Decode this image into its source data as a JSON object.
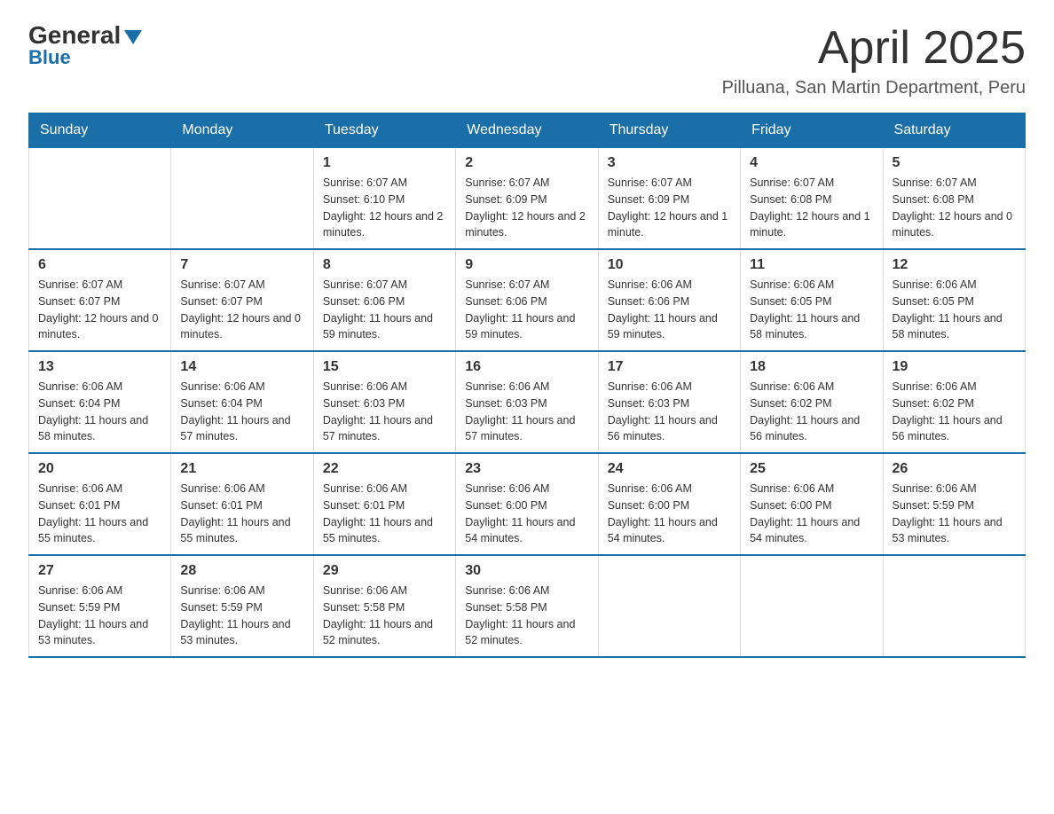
{
  "logo": {
    "general": "General",
    "blue": "Blue"
  },
  "header": {
    "month": "April 2025",
    "location": "Pilluana, San Martin Department, Peru"
  },
  "days_of_week": [
    "Sunday",
    "Monday",
    "Tuesday",
    "Wednesday",
    "Thursday",
    "Friday",
    "Saturday"
  ],
  "weeks": [
    {
      "days": [
        {
          "num": "",
          "info": ""
        },
        {
          "num": "",
          "info": ""
        },
        {
          "num": "1",
          "info": "Sunrise: 6:07 AM\nSunset: 6:10 PM\nDaylight: 12 hours and 2 minutes."
        },
        {
          "num": "2",
          "info": "Sunrise: 6:07 AM\nSunset: 6:09 PM\nDaylight: 12 hours and 2 minutes."
        },
        {
          "num": "3",
          "info": "Sunrise: 6:07 AM\nSunset: 6:09 PM\nDaylight: 12 hours and 1 minute."
        },
        {
          "num": "4",
          "info": "Sunrise: 6:07 AM\nSunset: 6:08 PM\nDaylight: 12 hours and 1 minute."
        },
        {
          "num": "5",
          "info": "Sunrise: 6:07 AM\nSunset: 6:08 PM\nDaylight: 12 hours and 0 minutes."
        }
      ]
    },
    {
      "days": [
        {
          "num": "6",
          "info": "Sunrise: 6:07 AM\nSunset: 6:07 PM\nDaylight: 12 hours and 0 minutes."
        },
        {
          "num": "7",
          "info": "Sunrise: 6:07 AM\nSunset: 6:07 PM\nDaylight: 12 hours and 0 minutes."
        },
        {
          "num": "8",
          "info": "Sunrise: 6:07 AM\nSunset: 6:06 PM\nDaylight: 11 hours and 59 minutes."
        },
        {
          "num": "9",
          "info": "Sunrise: 6:07 AM\nSunset: 6:06 PM\nDaylight: 11 hours and 59 minutes."
        },
        {
          "num": "10",
          "info": "Sunrise: 6:06 AM\nSunset: 6:06 PM\nDaylight: 11 hours and 59 minutes."
        },
        {
          "num": "11",
          "info": "Sunrise: 6:06 AM\nSunset: 6:05 PM\nDaylight: 11 hours and 58 minutes."
        },
        {
          "num": "12",
          "info": "Sunrise: 6:06 AM\nSunset: 6:05 PM\nDaylight: 11 hours and 58 minutes."
        }
      ]
    },
    {
      "days": [
        {
          "num": "13",
          "info": "Sunrise: 6:06 AM\nSunset: 6:04 PM\nDaylight: 11 hours and 58 minutes."
        },
        {
          "num": "14",
          "info": "Sunrise: 6:06 AM\nSunset: 6:04 PM\nDaylight: 11 hours and 57 minutes."
        },
        {
          "num": "15",
          "info": "Sunrise: 6:06 AM\nSunset: 6:03 PM\nDaylight: 11 hours and 57 minutes."
        },
        {
          "num": "16",
          "info": "Sunrise: 6:06 AM\nSunset: 6:03 PM\nDaylight: 11 hours and 57 minutes."
        },
        {
          "num": "17",
          "info": "Sunrise: 6:06 AM\nSunset: 6:03 PM\nDaylight: 11 hours and 56 minutes."
        },
        {
          "num": "18",
          "info": "Sunrise: 6:06 AM\nSunset: 6:02 PM\nDaylight: 11 hours and 56 minutes."
        },
        {
          "num": "19",
          "info": "Sunrise: 6:06 AM\nSunset: 6:02 PM\nDaylight: 11 hours and 56 minutes."
        }
      ]
    },
    {
      "days": [
        {
          "num": "20",
          "info": "Sunrise: 6:06 AM\nSunset: 6:01 PM\nDaylight: 11 hours and 55 minutes."
        },
        {
          "num": "21",
          "info": "Sunrise: 6:06 AM\nSunset: 6:01 PM\nDaylight: 11 hours and 55 minutes."
        },
        {
          "num": "22",
          "info": "Sunrise: 6:06 AM\nSunset: 6:01 PM\nDaylight: 11 hours and 55 minutes."
        },
        {
          "num": "23",
          "info": "Sunrise: 6:06 AM\nSunset: 6:00 PM\nDaylight: 11 hours and 54 minutes."
        },
        {
          "num": "24",
          "info": "Sunrise: 6:06 AM\nSunset: 6:00 PM\nDaylight: 11 hours and 54 minutes."
        },
        {
          "num": "25",
          "info": "Sunrise: 6:06 AM\nSunset: 6:00 PM\nDaylight: 11 hours and 54 minutes."
        },
        {
          "num": "26",
          "info": "Sunrise: 6:06 AM\nSunset: 5:59 PM\nDaylight: 11 hours and 53 minutes."
        }
      ]
    },
    {
      "days": [
        {
          "num": "27",
          "info": "Sunrise: 6:06 AM\nSunset: 5:59 PM\nDaylight: 11 hours and 53 minutes."
        },
        {
          "num": "28",
          "info": "Sunrise: 6:06 AM\nSunset: 5:59 PM\nDaylight: 11 hours and 53 minutes."
        },
        {
          "num": "29",
          "info": "Sunrise: 6:06 AM\nSunset: 5:58 PM\nDaylight: 11 hours and 52 minutes."
        },
        {
          "num": "30",
          "info": "Sunrise: 6:06 AM\nSunset: 5:58 PM\nDaylight: 11 hours and 52 minutes."
        },
        {
          "num": "",
          "info": ""
        },
        {
          "num": "",
          "info": ""
        },
        {
          "num": "",
          "info": ""
        }
      ]
    }
  ]
}
